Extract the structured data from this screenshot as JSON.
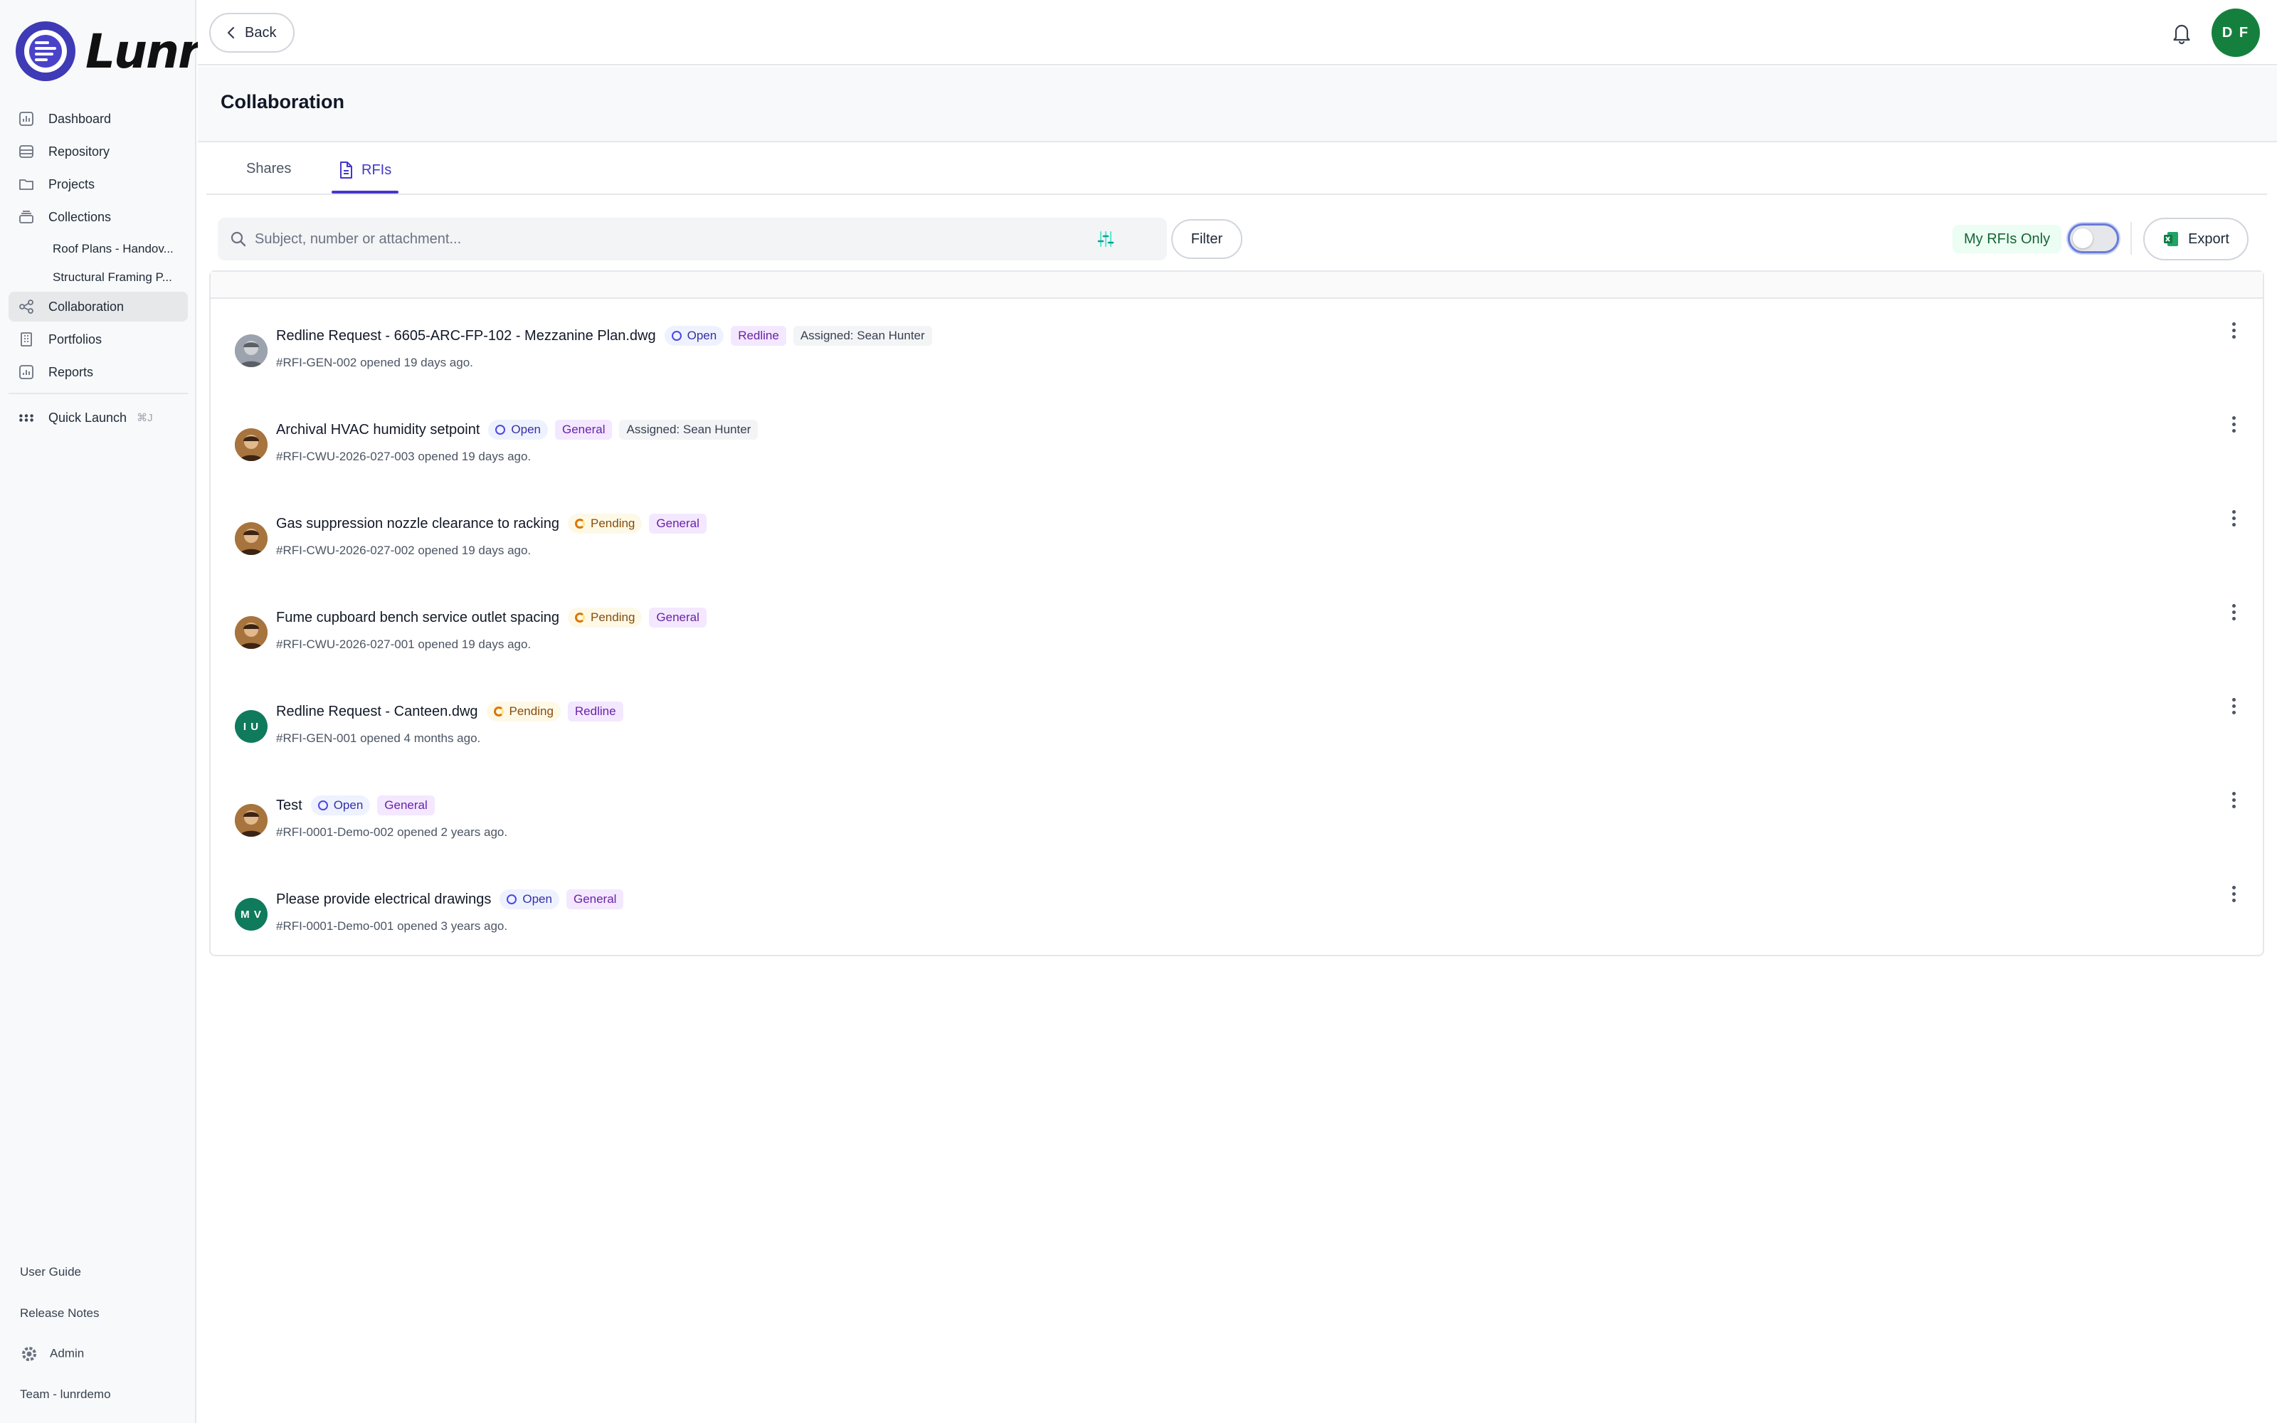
{
  "brand": {
    "name": "Lunr",
    "colors": {
      "primary": "#4338ca",
      "avatar": "#15803d"
    }
  },
  "sidebar": {
    "items": [
      {
        "label": "Dashboard",
        "icon": "chart-icon"
      },
      {
        "label": "Repository",
        "icon": "database-icon"
      },
      {
        "label": "Projects",
        "icon": "folder-icon"
      },
      {
        "label": "Collections",
        "icon": "stack-icon"
      }
    ],
    "collections": [
      {
        "label": "Roof Plans - Handov..."
      },
      {
        "label": "Structural Framing P..."
      }
    ],
    "items_after": [
      {
        "label": "Collaboration",
        "icon": "share-icon",
        "active": true
      },
      {
        "label": "Portfolios",
        "icon": "building-icon"
      },
      {
        "label": "Reports",
        "icon": "report-icon"
      }
    ],
    "quick_launch": {
      "label": "Quick Launch",
      "shortcut": "⌘J"
    },
    "bottom": {
      "user_guide": "User Guide",
      "release_notes": "Release Notes",
      "admin": "Admin",
      "team": "Team - lunrdemo"
    }
  },
  "topbar": {
    "back_label": "Back",
    "user_initials": "D F"
  },
  "page": {
    "title": "Collaboration"
  },
  "tabs": [
    {
      "label": "Shares",
      "active": false
    },
    {
      "label": "RFIs",
      "active": true
    }
  ],
  "toolbar": {
    "search_placeholder": "Subject, number or attachment...",
    "filter_label": "Filter",
    "my_rfis_label": "My RFIs Only",
    "my_rfis_on": false,
    "export_label": "Export"
  },
  "rfis": [
    {
      "title": "Redline Request - 6605-ARC-FP-102 - Mezzanine Plan.dwg",
      "status": "Open",
      "type": "Redline",
      "assigned": "Assigned: Sean Hunter",
      "meta": "#RFI-GEN-002 opened 19 days ago.",
      "avatar": "photo-gray",
      "initials": ""
    },
    {
      "title": "Archival HVAC humidity setpoint",
      "status": "Open",
      "type": "General",
      "assigned": "Assigned: Sean Hunter",
      "meta": "#RFI-CWU-2026-027-003 opened 19 days ago.",
      "avatar": "photo",
      "initials": ""
    },
    {
      "title": "Gas suppression nozzle clearance to racking",
      "status": "Pending",
      "type": "General",
      "assigned": "",
      "meta": "#RFI-CWU-2026-027-002 opened 19 days ago.",
      "avatar": "photo",
      "initials": ""
    },
    {
      "title": "Fume cupboard bench service outlet spacing",
      "status": "Pending",
      "type": "General",
      "assigned": "",
      "meta": "#RFI-CWU-2026-027-001 opened 19 days ago.",
      "avatar": "photo",
      "initials": ""
    },
    {
      "title": "Redline Request - Canteen.dwg",
      "status": "Pending",
      "type": "Redline",
      "assigned": "",
      "meta": "#RFI-GEN-001 opened 4 months ago.",
      "avatar": "init",
      "initials": "I U"
    },
    {
      "title": "Test",
      "status": "Open",
      "type": "General",
      "assigned": "",
      "meta": "#RFI-0001-Demo-002 opened 2 years ago.",
      "avatar": "photo",
      "initials": ""
    },
    {
      "title": "Please provide electrical drawings",
      "status": "Open",
      "type": "General",
      "assigned": "",
      "meta": "#RFI-0001-Demo-001 opened 3 years ago.",
      "avatar": "init",
      "initials": "M V"
    }
  ]
}
